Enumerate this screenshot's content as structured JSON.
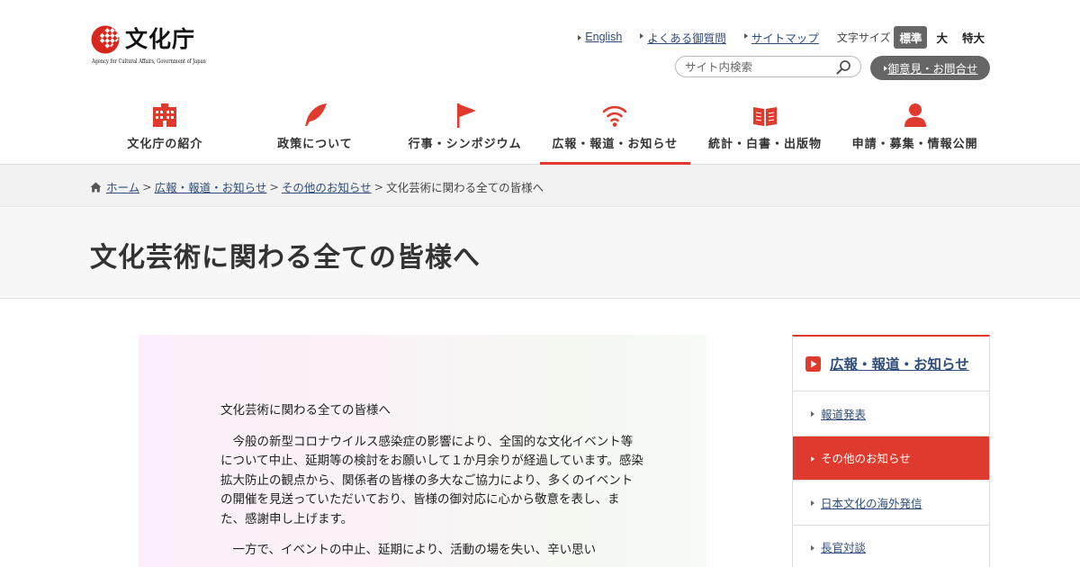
{
  "logo": {
    "title": "文化庁",
    "subtitle": "Agency for Cultural Affairs, Government of Japan"
  },
  "utility": {
    "links": [
      "English",
      "よくある御質問",
      "サイトマップ"
    ],
    "font_size_label": "文字サイズ",
    "font_sizes": [
      "標準",
      "大",
      "特大"
    ],
    "font_size_selected": "標準",
    "search_placeholder": "サイト内検索",
    "opinion_button": "御意見・お問合せ"
  },
  "global_nav": [
    {
      "label": "文化庁の紹介",
      "icon": "building-icon"
    },
    {
      "label": "政策について",
      "icon": "quill-icon"
    },
    {
      "label": "行事・シンポジウム",
      "icon": "flag-icon"
    },
    {
      "label": "広報・報道・お知らせ",
      "icon": "broadcast-icon",
      "active": true
    },
    {
      "label": "統計・白書・出版物",
      "icon": "book-icon"
    },
    {
      "label": "申請・募集・情報公開",
      "icon": "person-icon"
    }
  ],
  "breadcrumb": {
    "items": [
      "ホーム",
      "広報・報道・お知らせ",
      "その他のお知らせ"
    ],
    "current": "文化芸術に関わる全ての皆様へ",
    "separator": ">"
  },
  "page_title": "文化芸術に関わる全ての皆様へ",
  "letter": {
    "greeting": "文化芸術に関わる全ての皆様へ",
    "para1": "今般の新型コロナウイルス感染症の影響により、全国的な文化イベント等について中止、延期等の検討をお願いして１か月余りが経過しています。感染拡大防止の観点から、関係者の皆様の多大なご協力により、多くのイベントの開催を見送っていただいており、皆様の御対応に心から敬意を表し、また、感謝申し上げます。",
    "para2": "一方で、イベントの中止、延期により、活動の場を失い、辛い思い"
  },
  "side_nav": {
    "heading": "広報・報道・お知らせ",
    "items": [
      "報道発表",
      "その他のお知らせ",
      "日本文化の海外発信",
      "長官対談"
    ],
    "selected": "その他のお知らせ"
  },
  "colors": {
    "accent_red": "#e03a2e",
    "link_blue": "#2f4d7a",
    "button_gray": "#666666"
  }
}
